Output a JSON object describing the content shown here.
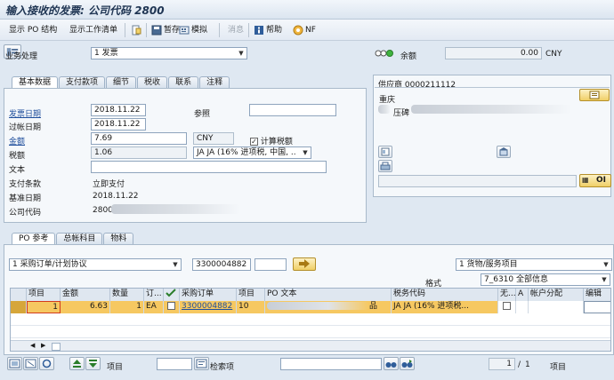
{
  "window": {
    "title": "输入接收的发票: 公司代码 2800"
  },
  "toolbar": {
    "show_po_structure": "显示 PO 结构",
    "show_worklist": "显示工作清单",
    "hold": "暂存",
    "simulate": "模拟",
    "messages": "消息",
    "help": "帮助",
    "nf": "NF"
  },
  "header": {
    "transaction_label": "业务处理",
    "transaction_value": "1 发票",
    "balance_label": "余额",
    "balance_value": "0.00",
    "balance_currency": "CNY"
  },
  "tabs": {
    "items": [
      "基本数据",
      "支付款项",
      "细节",
      "税收",
      "联系",
      "注释"
    ]
  },
  "basic": {
    "invoice_date_label": "发票日期",
    "invoice_date": "2018.11.22",
    "reference_label": "参照",
    "reference_value": "",
    "posting_date_label": "过帐日期",
    "posting_date": "2018.11.22",
    "amount_label": "金额",
    "amount": "7.69",
    "currency": "CNY",
    "calc_tax_label": "计算税额",
    "calc_tax_checked": true,
    "tax_label": "税额",
    "tax": "1.06",
    "tax_code": "JA JA (16% 进项税, 中国, ..",
    "text_label": "文本",
    "text_value": "",
    "payment_terms_label": "支付条款",
    "payment_terms": "立即支付",
    "baseline_date_label": "基准日期",
    "baseline_date": "2018.11.22",
    "company_code_label": "公司代码",
    "company_code": "2800"
  },
  "vendor": {
    "title": "供应商 0000211112",
    "city": "重庆",
    "name_fragment": "压碑",
    "oi_label": "OI"
  },
  "lower_tabs": {
    "items": [
      "PO 参考",
      "总帐科目",
      "物料"
    ]
  },
  "po_ref": {
    "ref_type": "1 采购订单/计划协议",
    "po_number": "3300004882",
    "item": "",
    "layout_value": "1 货物/服务项目",
    "format_label": "格式",
    "format_value": "7_6310 全部信息"
  },
  "grid": {
    "columns": [
      "项目",
      "金额",
      "数量",
      "订...",
      "",
      "采购订单",
      "项目",
      "PO 文本",
      "税务代码",
      "无...",
      "A",
      "帐户分配",
      "编辑"
    ],
    "rows": [
      {
        "item": "1",
        "amount": "6.63",
        "qty": "1",
        "unit": "EA",
        "po": "3300004882",
        "po_item": "10",
        "po_text": "品",
        "tax_code": "JA JA (16% 进项税..."
      }
    ]
  },
  "footer": {
    "item_label": "项目",
    "search_label": "检索项",
    "page_current": "1",
    "page_sep": "/",
    "page_total": "1",
    "item_label_right": "项目"
  }
}
